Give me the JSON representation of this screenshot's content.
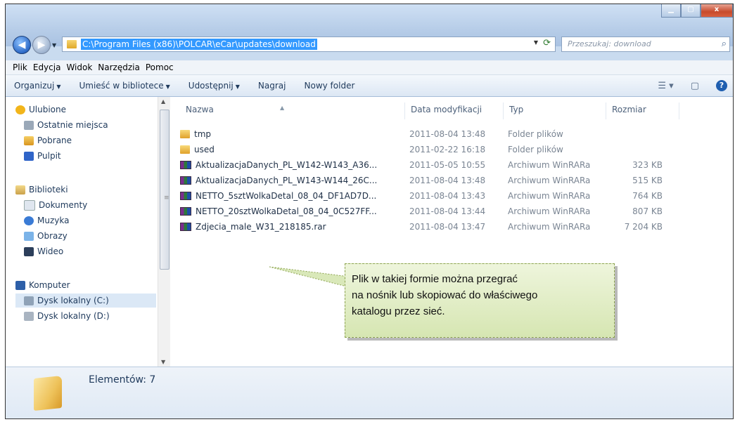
{
  "window": {
    "close_glyph": "x"
  },
  "addressbar": {
    "path": "C:\\Program Files (x86)\\POLCAR\\eCar\\updates\\download"
  },
  "search": {
    "placeholder": "Przeszukaj: download"
  },
  "menu": [
    "Plik",
    "Edycja",
    "Widok",
    "Narzędzia",
    "Pomoc"
  ],
  "toolbar": {
    "organize": "Organizuj",
    "library": "Umieść w bibliotece",
    "share": "Udostępnij",
    "burn": "Nagraj",
    "new_folder": "Nowy folder"
  },
  "navpane": {
    "favorites": "Ulubione",
    "recent": "Ostatnie miejsca",
    "downloads": "Pobrane",
    "desktop": "Pulpit",
    "libraries": "Biblioteki",
    "documents": "Dokumenty",
    "music": "Muzyka",
    "pictures": "Obrazy",
    "video": "Wideo",
    "computer": "Komputer",
    "disk_c": "Dysk lokalny (C:)",
    "disk_d": "Dysk lokalny (D:)"
  },
  "columns": {
    "name": "Nazwa",
    "date": "Data modyfikacji",
    "type": "Typ",
    "size": "Rozmiar"
  },
  "files": [
    {
      "name": "tmp",
      "date": "2011-08-04 13:48",
      "type": "Folder plików",
      "size": "",
      "icon": "folder-icon"
    },
    {
      "name": "used",
      "date": "2011-02-22 16:18",
      "type": "Folder plików",
      "size": "",
      "icon": "folder-icon"
    },
    {
      "name": "AktualizacjaDanych_PL_W142-W143_A36...",
      "date": "2011-05-05 10:55",
      "type": "Archiwum WinRARa",
      "size": "323 KB",
      "icon": "rar-icon"
    },
    {
      "name": "AktualizacjaDanych_PL_W143-W144_26C...",
      "date": "2011-08-04 13:48",
      "type": "Archiwum WinRARa",
      "size": "515 KB",
      "icon": "rar-icon"
    },
    {
      "name": "NETTO_5sztWolkaDetal_08_04_DF1AD7D...",
      "date": "2011-08-04 13:43",
      "type": "Archiwum WinRARa",
      "size": "764 KB",
      "icon": "rar-icon"
    },
    {
      "name": "NETTO_20sztWolkaDetal_08_04_0C527FF...",
      "date": "2011-08-04 13:44",
      "type": "Archiwum WinRARa",
      "size": "807 KB",
      "icon": "rar-icon"
    },
    {
      "name": "Zdjecia_male_W31_218185.rar",
      "date": "2011-08-04 13:47",
      "type": "Archiwum WinRARa",
      "size": "7 204 KB",
      "icon": "rar-icon"
    }
  ],
  "status": {
    "count": "Elementów: 7"
  },
  "callout": {
    "line1": "Plik w takiej formie można przegrać",
    "line2": "na nośnik lub skopiować do właściwego",
    "line3": "katalogu przez sieć."
  },
  "colors": {
    "selection": "#3399ff",
    "callout_bg": "#e2eec7",
    "link_text": "#1e395b"
  }
}
